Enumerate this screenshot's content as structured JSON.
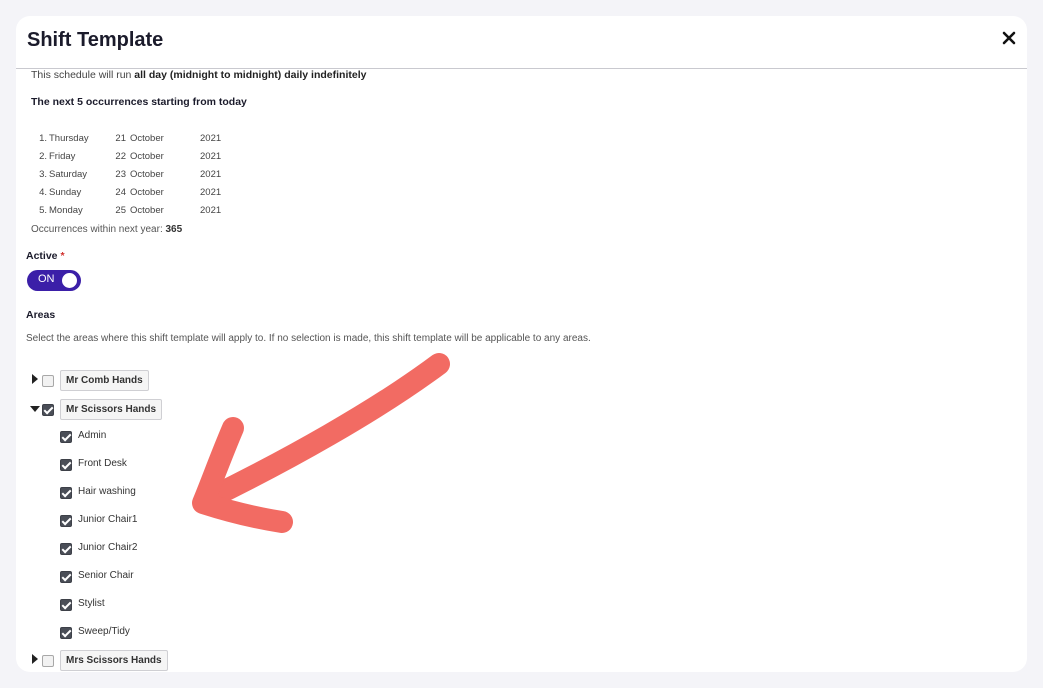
{
  "modal": {
    "title": "Shift Template"
  },
  "schedule": {
    "prefix": "This schedule will run ",
    "summary": "all day (midnight to midnight) daily indefinitely",
    "next_heading": "The next 5 occurrences starting from today",
    "occurrences": [
      {
        "idx": "1.",
        "day": "Thursday",
        "date": "21",
        "month": "October",
        "year": "2021"
      },
      {
        "idx": "2.",
        "day": "Friday",
        "date": "22",
        "month": "October",
        "year": "2021"
      },
      {
        "idx": "3.",
        "day": "Saturday",
        "date": "23",
        "month": "October",
        "year": "2021"
      },
      {
        "idx": "4.",
        "day": "Sunday",
        "date": "24",
        "month": "October",
        "year": "2021"
      },
      {
        "idx": "5.",
        "day": "Monday",
        "date": "25",
        "month": "October",
        "year": "2021"
      }
    ],
    "count_label": "Occurrences within next year: ",
    "count_value": "365"
  },
  "active": {
    "label": "Active",
    "required_mark": "*",
    "toggle_label": "ON",
    "toggle_color": "#3b1fa8"
  },
  "areas": {
    "label": "Areas",
    "description": "Select the areas where this shift template will apply to. If no selection is made, this shift template will be applicable to any areas.",
    "groups": [
      {
        "name": "Mr Comb Hands",
        "expanded": false,
        "checked": false,
        "children": []
      },
      {
        "name": "Mr Scissors Hands",
        "expanded": true,
        "checked": true,
        "children": [
          {
            "name": "Admin",
            "checked": true
          },
          {
            "name": "Front Desk",
            "checked": true
          },
          {
            "name": "Hair washing",
            "checked": true
          },
          {
            "name": "Junior Chair1",
            "checked": true
          },
          {
            "name": "Junior Chair2",
            "checked": true
          },
          {
            "name": "Senior Chair",
            "checked": true
          },
          {
            "name": "Stylist",
            "checked": true
          },
          {
            "name": "Sweep/Tidy",
            "checked": true
          }
        ]
      },
      {
        "name": "Mrs Scissors Hands",
        "expanded": false,
        "checked": false,
        "children": []
      }
    ]
  },
  "annotation": {
    "arrow_color": "#f26b63"
  },
  "icons": {
    "close": "close-icon",
    "caret_right": "caret-right-icon",
    "caret_down": "caret-down-icon",
    "arrow": "annotation-arrow-icon"
  }
}
